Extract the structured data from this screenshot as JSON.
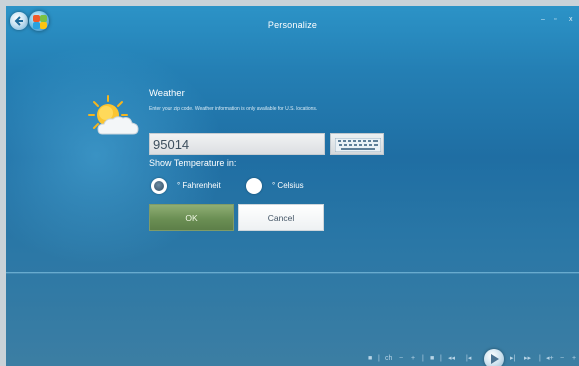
{
  "window": {
    "title": "Personalize",
    "controls": {
      "minimize": "–",
      "restore": "▫",
      "close": "x"
    }
  },
  "weather": {
    "heading": "Weather",
    "description": "Enter your zip code. Weather information is only available for U.S. locations.",
    "zip_value": "95014",
    "show_label": "Show Temperature in:",
    "options": [
      {
        "label": "° Fahrenheit",
        "selected": true
      },
      {
        "label": "° Celsius",
        "selected": false
      }
    ],
    "ok_label": "OK",
    "cancel_label": "Cancel"
  },
  "transport": {
    "ch_label": "ch",
    "minus": "−",
    "plus": "+",
    "sep": "|",
    "stop": "■",
    "rewind": "◂◂",
    "prev": "|◂",
    "next": "▸|",
    "ffwd": "▸▸",
    "mute": "◂+",
    "vol_minus": "−",
    "vol_plus": "+"
  },
  "colors": {
    "background_top": "#2c93c7",
    "background_bottom": "#3c7ea3",
    "ok_button": "#6b8f54",
    "cancel_button": "#ffffff"
  }
}
